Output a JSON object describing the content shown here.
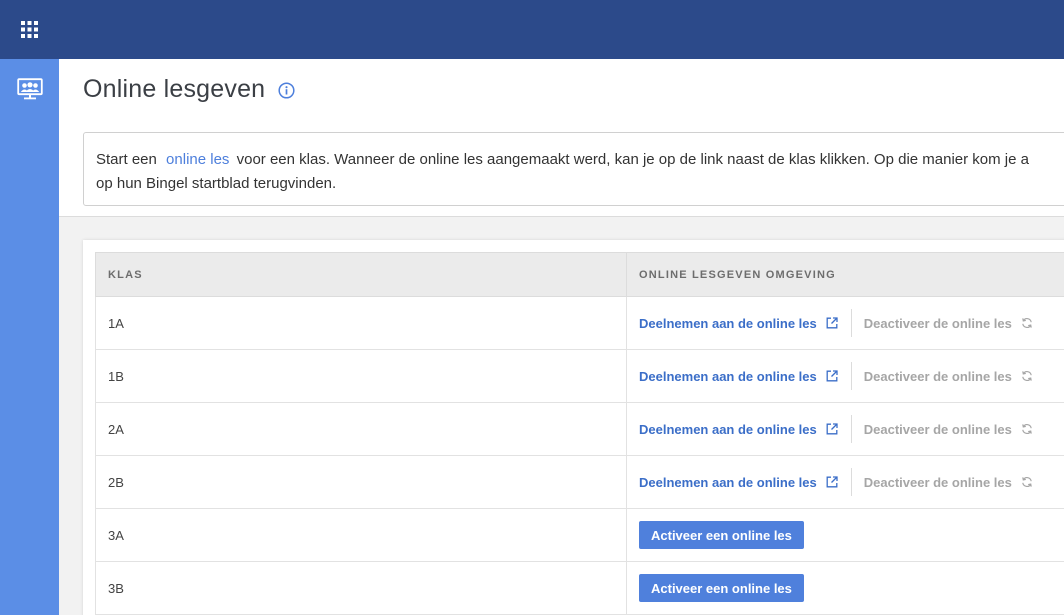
{
  "page": {
    "title": "Online lesgeven"
  },
  "intro": {
    "text_before": "Start een",
    "link_text": "online les",
    "text_after": "voor een klas. Wanneer de online les aangemaakt werd, kan je op de link naast de klas klikken. Op die manier kom je a",
    "line2": "op hun Bingel startblad terugvinden."
  },
  "table": {
    "headers": [
      "KLAS",
      "ONLINE LESGEVEN OMGEVING"
    ],
    "join_label": "Deelnemen aan de online les",
    "deactivate_label": "Deactiveer de online les",
    "activate_label": "Activeer een online les",
    "rows": [
      {
        "class": "1A",
        "status": "active"
      },
      {
        "class": "1B",
        "status": "active"
      },
      {
        "class": "2A",
        "status": "active"
      },
      {
        "class": "2B",
        "status": "active"
      },
      {
        "class": "3A",
        "status": "inactive"
      },
      {
        "class": "3B",
        "status": "inactive"
      }
    ]
  },
  "colors": {
    "topbar": "#2c4a8a",
    "sidebar": "#5b8ee6",
    "accent": "#4f80dc",
    "muted": "#a6a6a6"
  },
  "icons": {
    "apps": "grid-icon",
    "classroom": "classroom-presentation-icon",
    "info": "info-icon",
    "external": "external-link-icon",
    "refresh": "refresh-icon"
  }
}
